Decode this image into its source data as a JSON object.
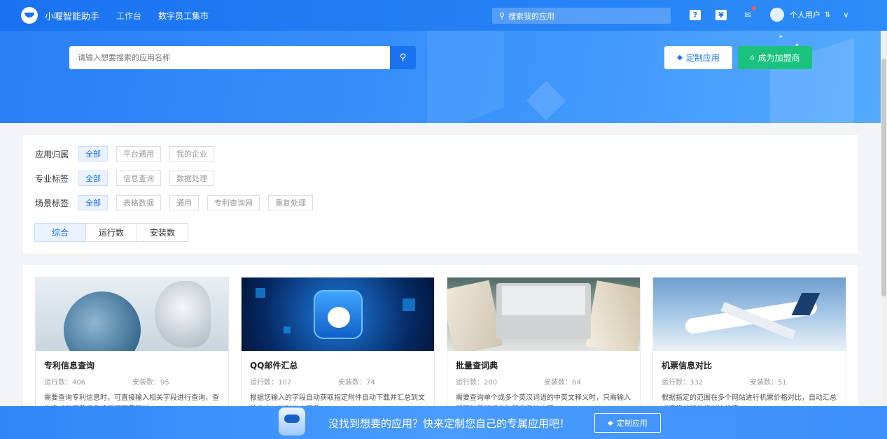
{
  "nav": {
    "brand": "小喔智能助手",
    "links": [
      "工作台",
      "数字员工集市"
    ],
    "search_placeholder": "搜索我的应用",
    "user_name": "个人用户",
    "user_extra": "⇅"
  },
  "banner": {
    "search_placeholder": "请输入想要搜索的应用名称",
    "custom_button": "定制应用",
    "join_button": "成为加盟商"
  },
  "filters": {
    "rows": [
      {
        "label": "应用归属",
        "tags": [
          "全部",
          "平台通用",
          "我的企业"
        ]
      },
      {
        "label": "专业标签",
        "tags": [
          "全部",
          "信息查询",
          "数据处理"
        ]
      },
      {
        "label": "场景标签",
        "tags": [
          "全部",
          "表格数据",
          "通用",
          "专利查询网",
          "重复处理"
        ]
      }
    ],
    "sorts": [
      "综合",
      "运行数",
      "安装数"
    ]
  },
  "cards": [
    {
      "title": "专利信息查询",
      "runs": "运行数：406",
      "installs": "安装数：95",
      "desc": "需要查询专利信息时，可直接输入相关字段进行查询，查询完成后下载任务结果即可获取对..."
    },
    {
      "title": "QQ邮件汇总",
      "runs": "运行数：107",
      "installs": "安装数：74",
      "desc": "根据您输入的字段自动获取指定附件自动下载并汇总到文件夹中，省时省力下载..."
    },
    {
      "title": "批量查词典",
      "runs": "运行数：200",
      "installs": "安装数：64",
      "desc": "需要查询单个或多个英汉词语的中英文释义时，只需输入即可批量翻译出你所需要的内容..."
    },
    {
      "title": "机票信息对比",
      "runs": "运行数：332",
      "installs": "安装数：51",
      "desc": "根据指定的范围在多个网站进行机票价格对比，自动汇总成表格并按价格对比排序..."
    }
  ],
  "promo": {
    "text": "没找到想要的应用？快来定制您自己的专属应用吧！",
    "button": "定制应用"
  },
  "colors": {
    "primary": "#1a72f0",
    "green": "#19c37d"
  }
}
